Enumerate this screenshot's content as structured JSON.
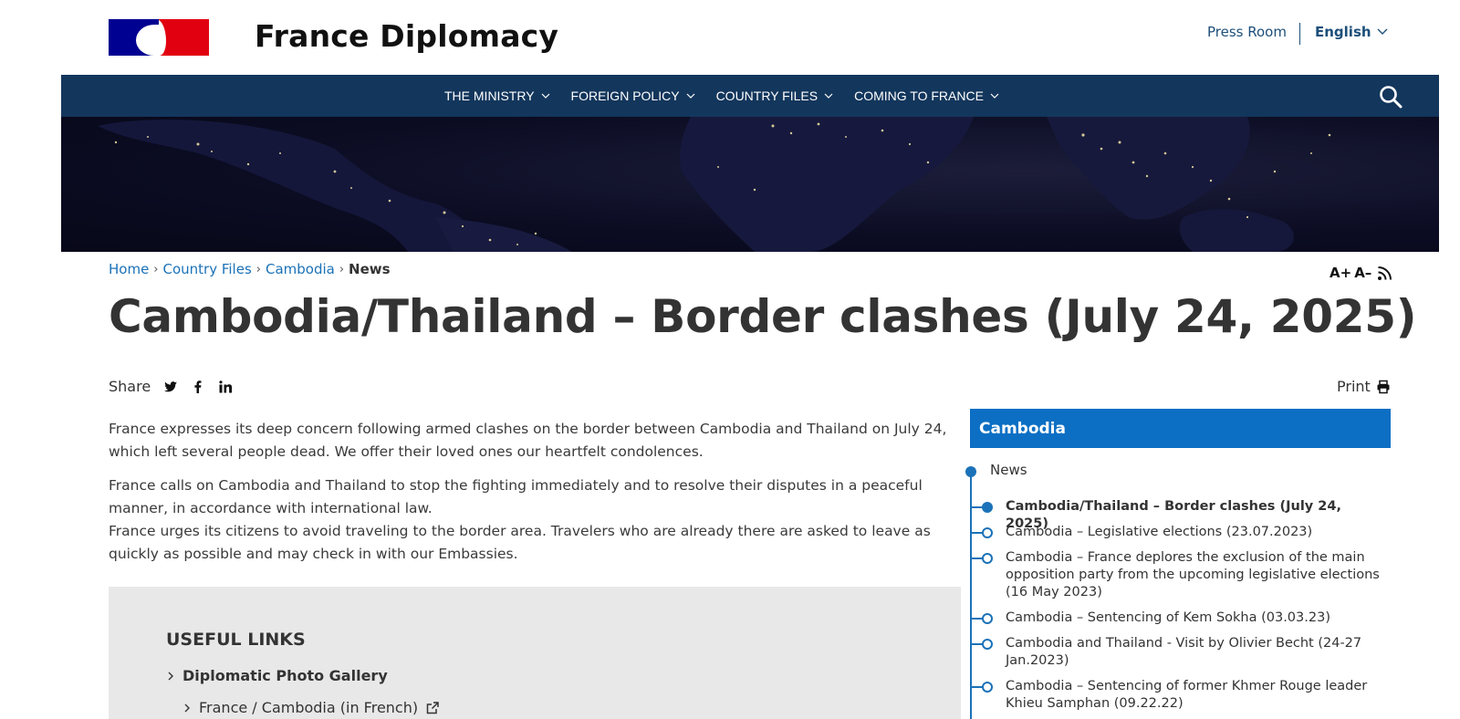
{
  "header": {
    "site_title": "France Diplomacy",
    "press_room": "Press Room",
    "language": "English"
  },
  "nav": {
    "items": [
      {
        "label": "THE MINISTRY"
      },
      {
        "label": "FOREIGN POLICY"
      },
      {
        "label": "COUNTRY FILES"
      },
      {
        "label": "COMING TO FRANCE"
      }
    ]
  },
  "breadcrumb": {
    "items": [
      "Home",
      "Country Files",
      "Cambodia"
    ],
    "current": "News"
  },
  "text_tools": {
    "increase": "A+",
    "decrease": "A–"
  },
  "article": {
    "title": "Cambodia/Thailand – Border clashes (July 24, 2025)",
    "share_label": "Share",
    "print_label": "Print",
    "paragraphs": [
      "France expresses its deep concern following armed clashes on the border between Cambodia and Thailand on July 24, which left several people dead. We offer their loved ones our heartfelt condolences.",
      "France calls on Cambodia and Thailand to stop the fighting immediately and to resolve their disputes in a peaceful manner, in accordance with international law.",
      "France urges its citizens to avoid traveling to the border area. Travelers who are already there are asked to leave as quickly as possible and may check in with our Embassies."
    ]
  },
  "useful_links": {
    "title": "USEFUL LINKS",
    "item": "Diplomatic Photo Gallery",
    "sub_item": "France / Cambodia (in French)"
  },
  "sidebar": {
    "heading": "Cambodia",
    "section": "News",
    "items": [
      {
        "label": "Cambodia/Thailand – Border clashes (July 24, 2025)",
        "active": true
      },
      {
        "label": "Cambodia – Legislative elections (23.07.2023)"
      },
      {
        "label": "Cambodia – France deplores the exclusion of the main opposition party from the upcoming legislative elections (16 May 2023)"
      },
      {
        "label": "Cambodia – Sentencing of Kem Sokha (03.03.23)"
      },
      {
        "label": "Cambodia and Thailand - Visit by Olivier Becht (24-27 Jan.2023)"
      },
      {
        "label": "Cambodia – Sentencing of former Khmer Rouge leader Khieu Samphan (09.22.22)"
      }
    ]
  },
  "colors": {
    "nav_bg": "#13365c",
    "link": "#1b72b8",
    "sidebar_head": "#0c6fc4",
    "flag_blue": "#000091",
    "flag_red": "#e1000f",
    "useful_bg": "#e8e8e9"
  }
}
